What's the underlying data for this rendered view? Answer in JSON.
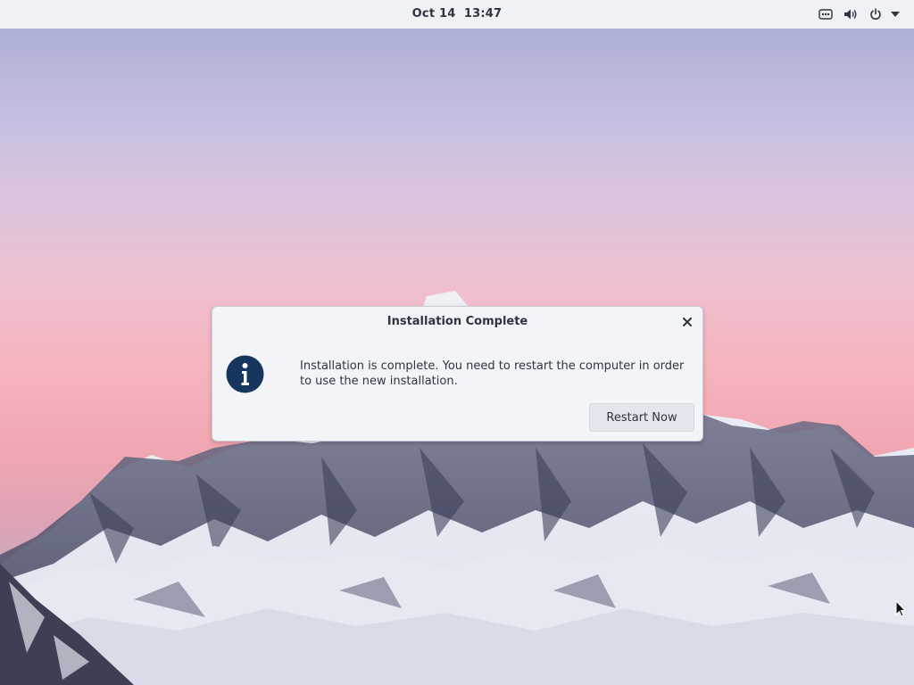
{
  "topbar": {
    "date": "Oct 14",
    "time": "13:47",
    "icons": [
      "network-icon",
      "volume-icon",
      "power-icon",
      "system-menu-arrow-icon"
    ]
  },
  "wallpaper": {
    "subject": "snow-covered-mountains",
    "sky_colors": [
      "#aeb0d6",
      "#dcc4dd",
      "#f6b4bd",
      "#b5b7d2"
    ]
  },
  "dialog": {
    "title": "Installation Complete",
    "message": "Installation is complete. You need to restart the computer in order to use the new installation.",
    "icon": "info-icon",
    "close_icon": "close-icon",
    "restart_button_label": "Restart Now",
    "accent_color": "#17365d"
  }
}
